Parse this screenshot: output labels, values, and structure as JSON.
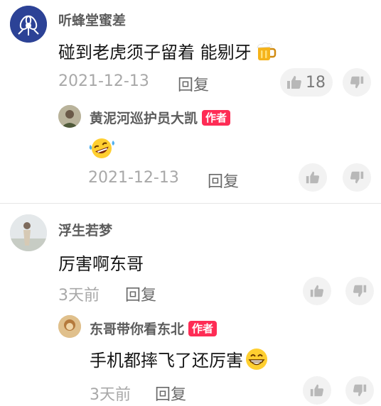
{
  "comments": [
    {
      "author": "听蜂堂蜜差",
      "text": "碰到老虎须子留着 能剔牙",
      "emoji": "beer-emoji",
      "date": "2021-12-13",
      "reply_label": "回复",
      "likes": "18",
      "reply": {
        "author": "黄泥河巡护员大凯",
        "badge": "作者",
        "emoji": "laughing-tears-emoji",
        "date": "2021-12-13",
        "reply_label": "回复"
      }
    },
    {
      "author": "浮生若梦",
      "text": "厉害啊东哥",
      "date": "3天前",
      "reply_label": "回复",
      "reply": {
        "author": "东哥带你看东北",
        "badge": "作者",
        "text": "手机都摔飞了还厉害",
        "emoji": "grin-emoji",
        "date": "3天前",
        "reply_label": "回复"
      }
    }
  ],
  "icons": {
    "like": "thumbs-up-icon",
    "dislike": "thumbs-down-icon"
  },
  "colors": {
    "author_badge": "#fe2c55"
  }
}
